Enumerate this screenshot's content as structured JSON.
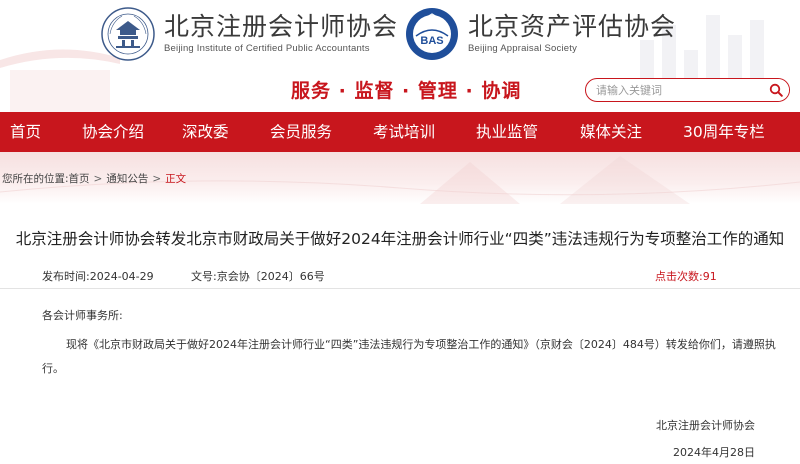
{
  "header": {
    "left_org": {
      "name_cn": "北京注册会计师协会",
      "name_en": "Beijing Institute of Certified Public Accountants"
    },
    "right_org": {
      "name_cn": "北京资产评估协会",
      "name_en": "Beijing Appraisal Society",
      "emblem_text": "BAS"
    },
    "slogan": "服务 · 监督 · 管理 · 协调",
    "search": {
      "placeholder": "请输入关键词",
      "icon": "search-icon"
    }
  },
  "nav": {
    "items": [
      {
        "label": "首页"
      },
      {
        "label": "协会介绍"
      },
      {
        "label": "深改委"
      },
      {
        "label": "会员服务"
      },
      {
        "label": "考试培训"
      },
      {
        "label": "执业监管"
      },
      {
        "label": "媒体关注"
      },
      {
        "label": "30周年专栏"
      }
    ]
  },
  "breadcrumb": {
    "prefix": "您所在的位置:",
    "items": [
      "首页",
      "通知公告",
      "正文"
    ],
    "separator": ">"
  },
  "article": {
    "title": "北京注册会计师协会转发北京市财政局关于做好2024年注册会计师行业“四类”违法违规行为专项整治工作的通知",
    "publish_label": "发布时间:",
    "publish_date": "2024-04-29",
    "docno_label": "文号:",
    "docno": "京会协〔2024〕66号",
    "hits_label": "点击次数:",
    "hits": "91",
    "salutation": "各会计师事务所:",
    "body": "现将《北京市财政局关于做好2024年注册会计师行业“四类”违法违规行为专项整治工作的通知》（京财会〔2024〕484号）转发给你们，请遵照执行。",
    "signature": "北京注册会计师协会",
    "sign_date": "2024年4月28日"
  },
  "colors": {
    "brand_red": "#c8161d",
    "text": "#333333"
  }
}
